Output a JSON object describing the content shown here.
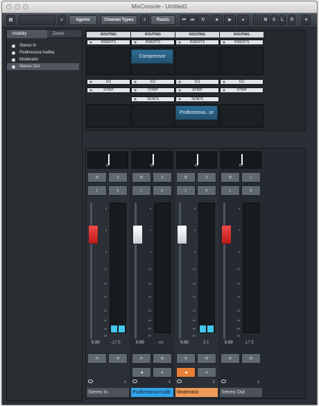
{
  "window": {
    "title": "MixConsole - Untitled1"
  },
  "toolbar": {
    "agents_label": "Agents",
    "channel_types_label": "Channel Types",
    "racks_label": "Racks",
    "stop_label": "■",
    "play_label": "▶",
    "record_label": "●",
    "m_label": "M",
    "s_label": "S",
    "l_label": "L",
    "r_label": "R"
  },
  "sidebar": {
    "tabs": [
      {
        "label": "Visibility"
      },
      {
        "label": "Zones"
      }
    ],
    "items": [
      {
        "label": "Stereo In"
      },
      {
        "label": "Podkresova hudba"
      },
      {
        "label": "Moderator"
      },
      {
        "label": "Stereo Out"
      }
    ]
  },
  "rack": {
    "routing_label": "ROUTING",
    "inserts_label": "INSERTS",
    "eq_label": "EQ",
    "strip_label": "STRIP",
    "sends_label": "SENDS",
    "insert_plugin_label": "Compressor",
    "send_plugin_label": "Podkresova...or"
  },
  "channels": [
    {
      "name": "Stereo In",
      "fader": "0.00",
      "peak": "-17.5",
      "number": "1"
    },
    {
      "name": "Podkresova hudb",
      "fader": "0.00",
      "peak": "-oo",
      "number": "1"
    },
    {
      "name": "Moderator",
      "fader": "0.00",
      "peak": "3.1",
      "number": "2"
    },
    {
      "name": "Stereo Out",
      "fader": "0.00",
      "peak": "-17.5",
      "number": "1"
    }
  ],
  "channel_buttons": {
    "m_label": "M",
    "s_label": "S",
    "l_label": "L",
    "e_label": "E",
    "r_label": "R",
    "w_label": "W"
  },
  "scale_labels": [
    "6",
    "0",
    "5",
    "10",
    "15",
    "20",
    "30",
    "40",
    "50",
    "60"
  ],
  "colors": {
    "blue": "#33a3ea",
    "orange": "#e97f36",
    "red": "#d62a2a"
  }
}
